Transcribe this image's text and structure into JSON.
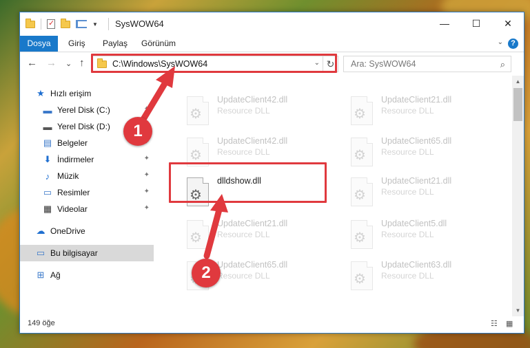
{
  "window": {
    "title": "SysWOW64",
    "controls": {
      "minimize": "—",
      "maximize": "☐",
      "close": "✕"
    }
  },
  "ribbon": {
    "tabs": [
      "Dosya",
      "Giriş",
      "Paylaş",
      "Görünüm"
    ],
    "help": "?"
  },
  "navigation": {
    "back": "←",
    "forward": "→",
    "recent": "⌄",
    "up": "↑",
    "address": "C:\\Windows\\SysWOW64",
    "refresh": "↻"
  },
  "search": {
    "placeholder": "Ara: SysWOW64",
    "icon": "🔍"
  },
  "sidebar": {
    "items": [
      {
        "label": "Hızlı erişim",
        "icon": "star-icon",
        "glyph": "★",
        "pinned": false
      },
      {
        "label": "Yerel Disk (C:)",
        "icon": "drive-icon",
        "glyph": "▬",
        "pinned": true
      },
      {
        "label": "Yerel Disk (D:)",
        "icon": "drive-icon",
        "glyph": "▬",
        "pinned": true
      },
      {
        "label": "Belgeler",
        "icon": "documents-icon",
        "glyph": "▤",
        "pinned": true
      },
      {
        "label": "İndirmeler",
        "icon": "downloads-icon",
        "glyph": "⬇",
        "pinned": true
      },
      {
        "label": "Müzik",
        "icon": "music-icon",
        "glyph": "♪",
        "pinned": true
      },
      {
        "label": "Resimler",
        "icon": "pictures-icon",
        "glyph": "▭",
        "pinned": true
      },
      {
        "label": "Videolar",
        "icon": "videos-icon",
        "glyph": "▦",
        "pinned": true
      },
      {
        "label": "OneDrive",
        "icon": "cloud-icon",
        "glyph": "☁",
        "pinned": false
      },
      {
        "label": "Bu bilgisayar",
        "icon": "computer-icon",
        "glyph": "▭",
        "pinned": false,
        "selected": true
      },
      {
        "label": "Ağ",
        "icon": "network-icon",
        "glyph": "⊞",
        "pinned": false
      }
    ],
    "pin_glyph": "📌"
  },
  "files": [
    {
      "name": "UpdateClient42.dll",
      "type": "Resource DLL",
      "faded": true
    },
    {
      "name": "UpdateClient21.dll",
      "type": "Resource DLL",
      "faded": true
    },
    {
      "name": "UpdateClient42.dll",
      "type": "Resource DLL",
      "faded": true
    },
    {
      "name": "UpdateClient65.dll",
      "type": "Resource DLL",
      "faded": true
    },
    {
      "name": "dlldshow.dll",
      "type": "",
      "faded": false
    },
    {
      "name": "UpdateClient21.dll",
      "type": "Resource DLL",
      "faded": true
    },
    {
      "name": "UpdateClient21.dll",
      "type": "Resource DLL",
      "faded": true
    },
    {
      "name": "UpdateClient5.dll",
      "type": "Resource DLL",
      "faded": true
    },
    {
      "name": "UpdateClient65.dll",
      "type": "Resource DLL",
      "faded": true
    },
    {
      "name": "UpdateClient63.dll",
      "type": "Resource DLL",
      "faded": true
    }
  ],
  "status": {
    "count": "149 öğe"
  },
  "annotations": {
    "badge1": "1",
    "badge2": "2",
    "accent": "#e0393e"
  }
}
